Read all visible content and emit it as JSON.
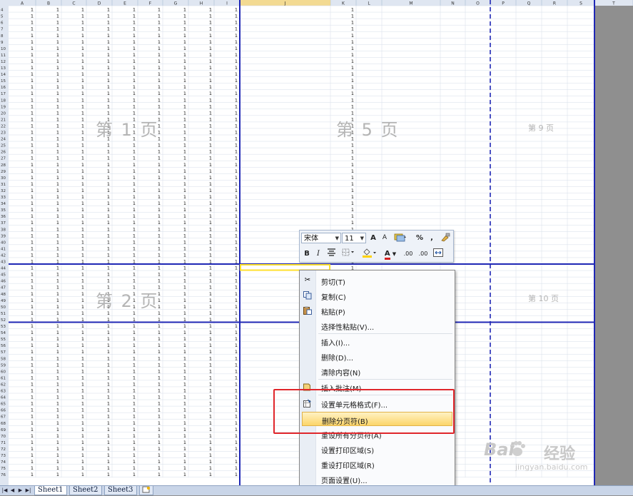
{
  "columns": [
    "A",
    "B",
    "C",
    "D",
    "E",
    "F",
    "G",
    "H",
    "I",
    "J",
    "K",
    "L",
    "M",
    "N",
    "O",
    "P",
    "Q",
    "R",
    "S",
    "T"
  ],
  "row_start": 4,
  "row_end": 76,
  "cell_value": "1",
  "page_labels": {
    "page1": "第 1 页",
    "page2": "第 2 页",
    "page5": "第 5 页",
    "page9": "第 9 页",
    "page10": "第 10 页"
  },
  "mini_toolbar": {
    "font_name": "宋体",
    "font_size": "11",
    "grow_font": "A",
    "shrink_font": "A",
    "percent": "%",
    "comma": ",",
    "bold": "B",
    "italic": "I",
    "font_color": "A",
    "inc_decimal": ".00",
    "dec_decimal": ".00"
  },
  "context_menu": {
    "items": [
      {
        "label": "剪切(T)",
        "icon": "scissors-icon"
      },
      {
        "label": "复制(C)",
        "icon": "copy-icon"
      },
      {
        "label": "粘贴(P)",
        "icon": "paste-icon"
      },
      {
        "label": "选择性粘贴(V)...",
        "icon": ""
      },
      {
        "label": "插入(I)...",
        "icon": ""
      },
      {
        "label": "删除(D)...",
        "icon": ""
      },
      {
        "label": "清除内容(N)",
        "icon": ""
      },
      {
        "label": "插入批注(M)",
        "icon": "comment-icon"
      },
      {
        "label": "设置单元格格式(F)...",
        "icon": "format-cells-icon"
      },
      {
        "label": "删除分页符(B)",
        "icon": ""
      },
      {
        "label": "重设所有分页符(A)",
        "icon": ""
      },
      {
        "label": "设置打印区域(S)",
        "icon": ""
      },
      {
        "label": "重设打印区域(R)",
        "icon": ""
      },
      {
        "label": "页面设置(U)...",
        "icon": ""
      }
    ]
  },
  "sheet_tabs": [
    "Sheet1",
    "Sheet2",
    "Sheet3"
  ],
  "watermark": {
    "brand": "Bai",
    "brand2": "经验",
    "url": "jingyan.baidu.com"
  },
  "colors": {
    "page_break": "#1f27b5",
    "highlight_box": "#e0262b",
    "selected_cell": "#ffe12e"
  }
}
